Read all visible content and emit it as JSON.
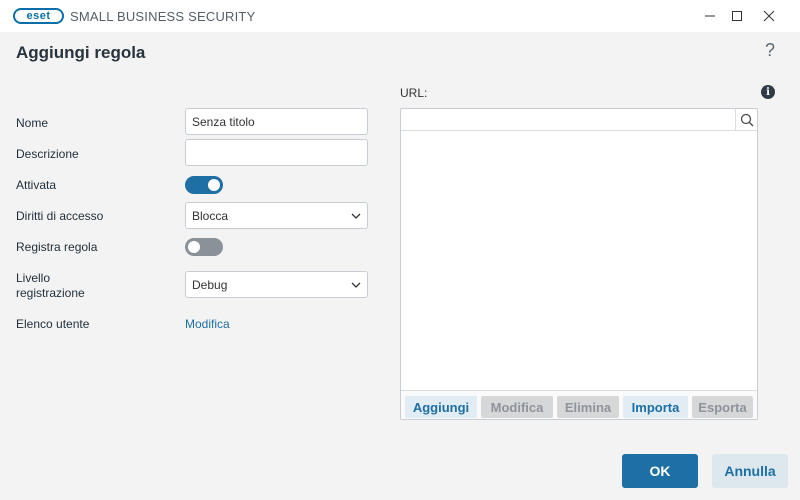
{
  "window": {
    "logo_text": "eset",
    "title": "SMALL BUSINESS SECURITY"
  },
  "dialog": {
    "title": "Aggiungi regola",
    "help": "?"
  },
  "form": {
    "name": {
      "label": "Nome",
      "value": "Senza titolo"
    },
    "description": {
      "label": "Descrizione",
      "value": ""
    },
    "enabled": {
      "label": "Attivata",
      "state": true
    },
    "access_rights": {
      "label": "Diritti di accesso",
      "value": "Blocca"
    },
    "log_rule": {
      "label": "Registra regola",
      "state": false
    },
    "log_level": {
      "label_line1": "Livello",
      "label_line2": "registrazione",
      "value": "Debug"
    },
    "user_list": {
      "label": "Elenco utente",
      "link": "Modifica"
    }
  },
  "url_panel": {
    "label": "URL:",
    "search_value": "",
    "items": [],
    "actions": [
      {
        "label": "Aggiungi",
        "enabled": true
      },
      {
        "label": "Modifica",
        "enabled": false
      },
      {
        "label": "Elimina",
        "enabled": false
      },
      {
        "label": "Importa",
        "enabled": true
      },
      {
        "label": "Esporta",
        "enabled": false
      }
    ]
  },
  "buttons": {
    "ok": "OK",
    "cancel": "Annulla"
  },
  "colors": {
    "accent": "#1e6fa3",
    "toggle_off": "#8b9198",
    "disabled_button": "#d5d7d9"
  }
}
